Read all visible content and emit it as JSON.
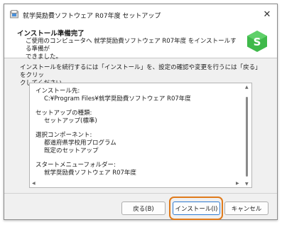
{
  "window": {
    "title": "就学奨励費ソフトウェア R07年度 セットアップ",
    "close_glyph": "✕"
  },
  "header": {
    "title": "インストール準備完了",
    "desc_line1": "ご使用のコンピュータへ 就学奨励費ソフトウェア R07年度 をインストールする準備が",
    "desc_line2": "できました。",
    "logo_letter": "S",
    "logo_color": "#3fb94a"
  },
  "instruction": {
    "line1": "インストールを続行するには「インストール」を、設定の確認や変更を行うには「戻る」をクリッ",
    "line2": "クしてください。"
  },
  "info": {
    "install_dest_label": "インストール先:",
    "install_dest_value": "C:¥Program Files¥就学奨励費ソフトウェア R07年度",
    "setup_type_label": "セットアップの種類:",
    "setup_type_value": "セットアップ(標準)",
    "components_label": "選択コンポーネント:",
    "component_1": "都道府県学校用プログラム",
    "component_2": "既定のセットアップ",
    "startmenu_label": "スタートメニューフォルダー:",
    "startmenu_value": "就学奨励費ソフトウェア R07年度",
    "scroll_left": "◀",
    "scroll_right": "▶",
    "scroll_up": "▲",
    "scroll_down": "▼"
  },
  "buttons": {
    "back": "戻る(B)",
    "install": "インストール(I)",
    "cancel": "キャンセル"
  },
  "colors": {
    "highlight": "#e07b1c",
    "primary_border": "#2f7bd1"
  }
}
